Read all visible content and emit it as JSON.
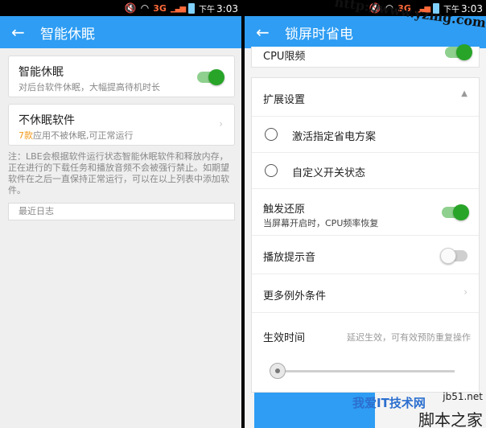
{
  "status": {
    "network": "3G",
    "ampm": "下午",
    "time": "3:03"
  },
  "left": {
    "title": "智能休眠",
    "smart_sleep": {
      "label": "智能休眠",
      "desc": "对后台软件休眠，大幅提高待机时长",
      "enabled": true
    },
    "no_sleep": {
      "label": "不休眠软件",
      "count": "7款",
      "desc": "应用不被休眠,可正常运行"
    },
    "note": "注：LBE会根据软件运行状态智能休眠软件和释放内存，正在进行的下载任务和播放音频不会被强行禁止。如期望软件在之后一直保持正常运行，可以在以上列表中添加软件。",
    "recent_log": "最近日志"
  },
  "right": {
    "title": "锁屏时省电",
    "cpu_limit": "CPU限频",
    "expand_settings": "扩展设置",
    "activate_plan": "激活指定省电方案",
    "custom_switch": "自定义开关状态",
    "trigger_restore": {
      "label": "触发还原",
      "desc": "当屏幕开启时，CPU频率恢复",
      "enabled": true
    },
    "play_sound": {
      "label": "播放提示音",
      "enabled": false
    },
    "more_conditions": "更多例外条件",
    "effective_time": {
      "label": "生效时间",
      "hint": "延迟生效，可有效预防重复操作"
    }
  },
  "watermarks": {
    "top_url": "http://www.yzmg.com",
    "bottom_brand": "我爱IT技术网",
    "bottom_url": "jb51.net",
    "bottom_site": "脚本之家"
  },
  "colors": {
    "primary": "#2e9df3",
    "toggle_on": "#28a428",
    "accent_orange": "#f39a1a"
  }
}
